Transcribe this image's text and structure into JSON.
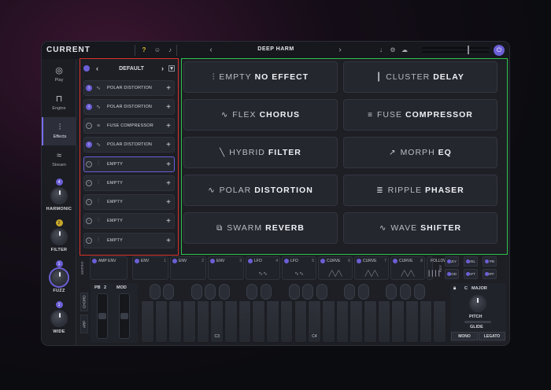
{
  "app": {
    "logo": "CURRENT",
    "preset": "DEEP HARM"
  },
  "topbar": {
    "help": "?",
    "user": "☺",
    "bell": "♪",
    "prev": "‹",
    "next": "›",
    "save": "↓",
    "settings": "⚙",
    "cloud": "☁",
    "power": "⏻"
  },
  "nav": [
    {
      "label": "Play",
      "icon": "◎"
    },
    {
      "label": "Engine",
      "icon": "⊓"
    },
    {
      "label": "Effects",
      "icon": "⫶"
    },
    {
      "label": "Stream",
      "icon": "≈"
    }
  ],
  "macros": [
    {
      "label": "HARMONIC",
      "badge": "4"
    },
    {
      "label": "FILTER",
      "badge": "2"
    },
    {
      "label": "FUZZ",
      "badge": "1"
    },
    {
      "label": "WIDE",
      "badge": "1"
    }
  ],
  "chain": {
    "title": "DEFAULT",
    "slots": [
      {
        "name": "POLAR DISTORTION",
        "icon": "∿",
        "on": true
      },
      {
        "name": "POLAR DISTORTION",
        "icon": "∿",
        "on": true
      },
      {
        "name": "FUSE COMPRESSOR",
        "icon": "≡",
        "on": false
      },
      {
        "name": "POLAR DISTORTION",
        "icon": "∿",
        "on": true
      },
      {
        "name": "EMPTY",
        "icon": "⫶",
        "on": false
      },
      {
        "name": "EMPTY",
        "icon": "⫶",
        "on": false
      },
      {
        "name": "EMPTY",
        "icon": "⫶",
        "on": false
      },
      {
        "name": "EMPTY",
        "icon": "⫶",
        "on": false
      },
      {
        "name": "EMPTY",
        "icon": "⫶",
        "on": false
      }
    ]
  },
  "effects": [
    {
      "light": "EMPTY",
      "bold": "NO EFFECT",
      "icon": "⫶"
    },
    {
      "light": "CLUSTER",
      "bold": "DELAY",
      "icon": "┃"
    },
    {
      "light": "FLEX",
      "bold": "CHORUS",
      "icon": "∿"
    },
    {
      "light": "FUSE",
      "bold": "COMPRESSOR",
      "icon": "≡"
    },
    {
      "light": "HYBRID",
      "bold": "FILTER",
      "icon": "╲"
    },
    {
      "light": "MORPH",
      "bold": "EQ",
      "icon": "↗"
    },
    {
      "light": "POLAR",
      "bold": "DISTORTION",
      "icon": "∿"
    },
    {
      "light": "RIPPLE",
      "bold": "PHASER",
      "icon": "≣"
    },
    {
      "light": "SWARM",
      "bold": "REVERB",
      "icon": "⧉"
    },
    {
      "light": "WAVE",
      "bold": "SHIFTER",
      "icon": "∿"
    }
  ],
  "mod": {
    "matrix_label": "MATRIX",
    "mods_label": "MODS",
    "key_label": "KEY",
    "slots": [
      {
        "name": "AMP ENV",
        "num": "",
        "wave": ""
      },
      {
        "name": "ENV",
        "num": "1",
        "wave": ""
      },
      {
        "name": "ENV",
        "num": "2",
        "wave": ""
      },
      {
        "name": "ENV",
        "num": "3",
        "wave": ""
      },
      {
        "name": "LFO",
        "num": "4",
        "wave": "∿∿"
      },
      {
        "name": "LFO",
        "num": "5",
        "wave": "∿∿"
      },
      {
        "name": "CURVE",
        "num": "6",
        "wave": "╱╲╱╲"
      },
      {
        "name": "CURVE",
        "num": "7",
        "wave": "╱╲╱╲"
      },
      {
        "name": "CURVE",
        "num": "8",
        "wave": "╱╲╱╲"
      },
      {
        "name": "FOLLOW",
        "num": "9",
        "wave": "┃┃┃┃"
      }
    ],
    "keys": [
      "KEY",
      "VEL",
      "PB",
      "MOD",
      "AFT",
      "OFF"
    ]
  },
  "keyboard": {
    "tabs": [
      "CHORD",
      "ARP"
    ],
    "pb_label": "PB",
    "pb_value": "2",
    "mod_label": "MOD",
    "c3": "C3",
    "c4": "C4",
    "key_root": "C",
    "scale": "MAJOR",
    "pitch_label": "PITCH",
    "glide_label": "GLIDE",
    "mono": "MONO",
    "legato": "LEGATO"
  }
}
